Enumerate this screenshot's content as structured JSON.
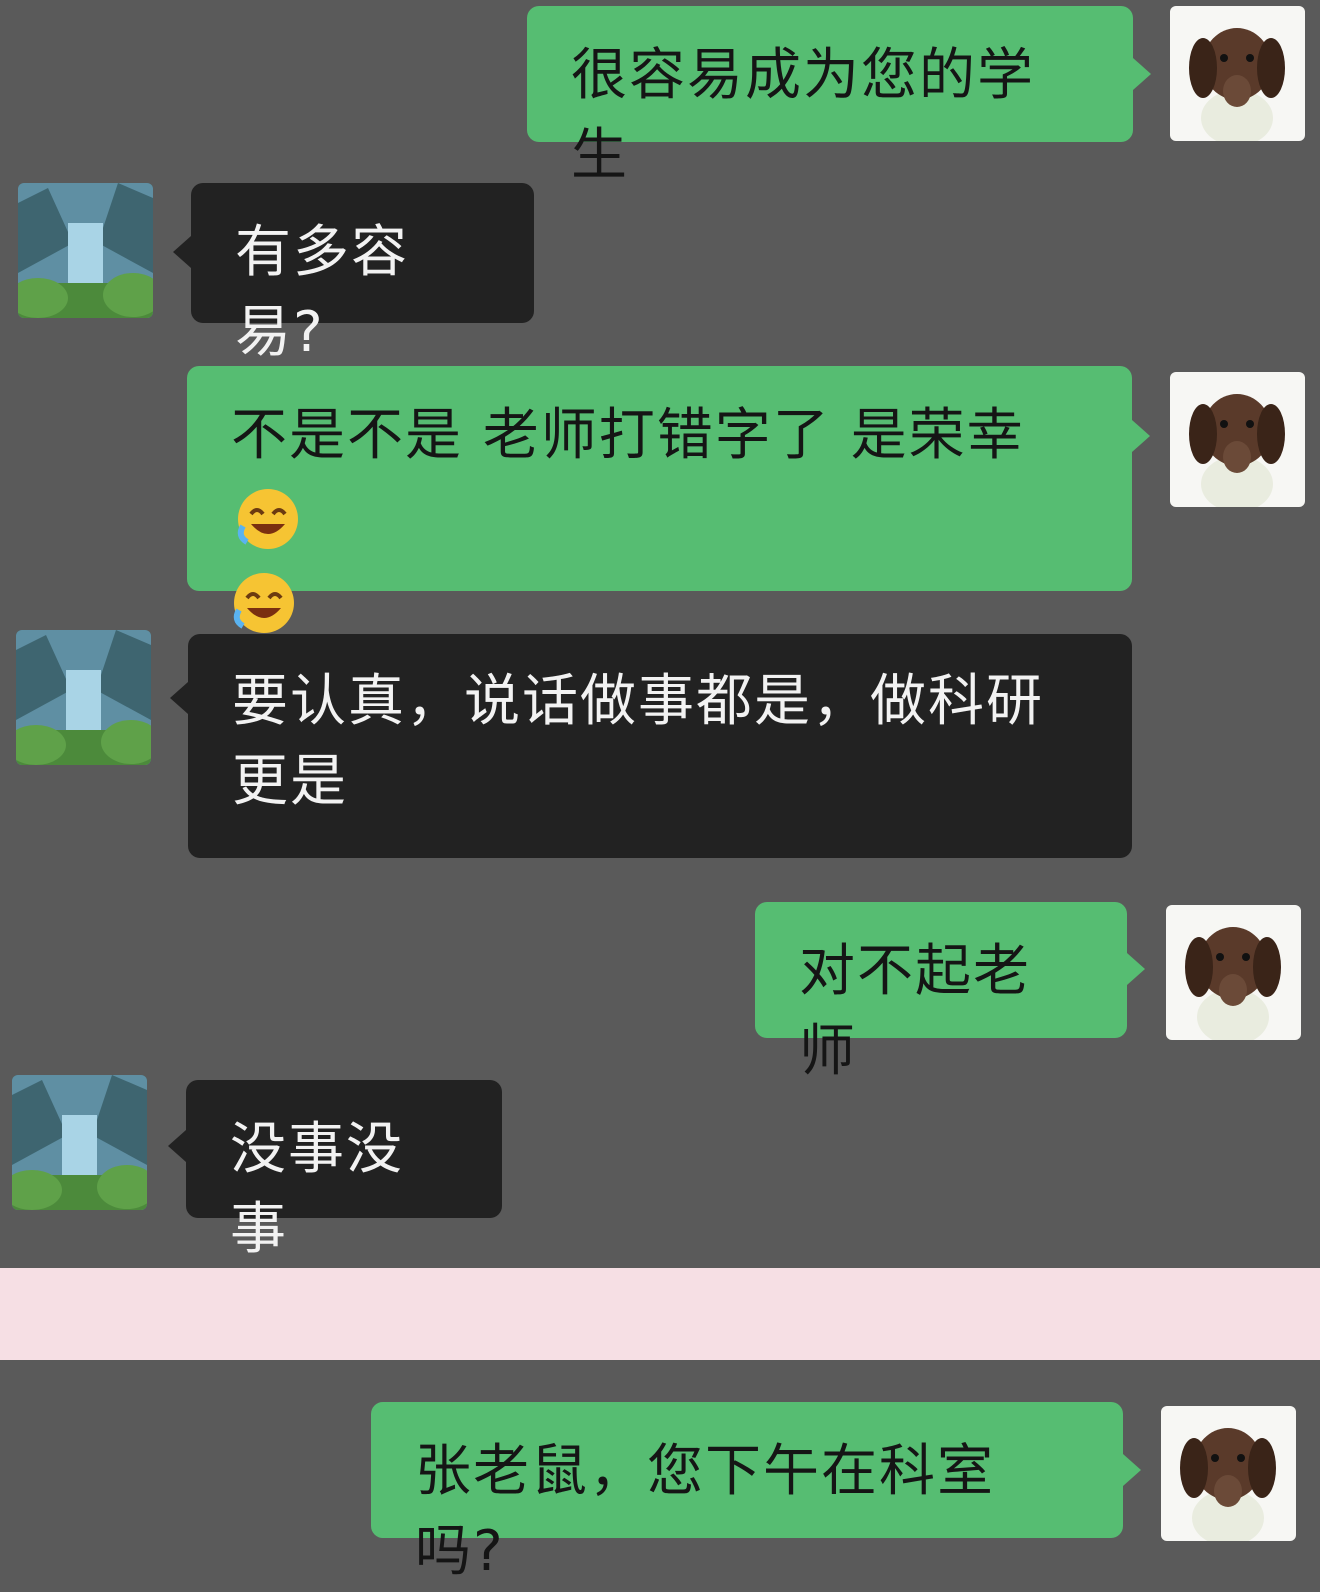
{
  "colors": {
    "background": "#5a5a5a",
    "outgoing_bubble": "#56bd72",
    "incoming_bubble": "#222222",
    "divider_band": "#f6dfe4"
  },
  "messages": [
    {
      "sender": "me",
      "text": "很容易成为您的学生"
    },
    {
      "sender": "teacher",
      "text": "有多容易?"
    },
    {
      "sender": "me",
      "text": "不是不是 老师打错字了 是荣幸",
      "emojis": [
        "laugh-cry-emoji",
        "laugh-cry-emoji"
      ]
    },
    {
      "sender": "teacher",
      "text": "要认真，说话做事都是，做科研更是"
    },
    {
      "sender": "me",
      "text": "对不起老师"
    },
    {
      "sender": "teacher",
      "text": "没事没事"
    },
    {
      "sender": "me",
      "text": "张老鼠，您下午在科室吗?"
    }
  ],
  "avatars": {
    "me": "dog-avatar",
    "teacher": "landscape-avatar"
  }
}
